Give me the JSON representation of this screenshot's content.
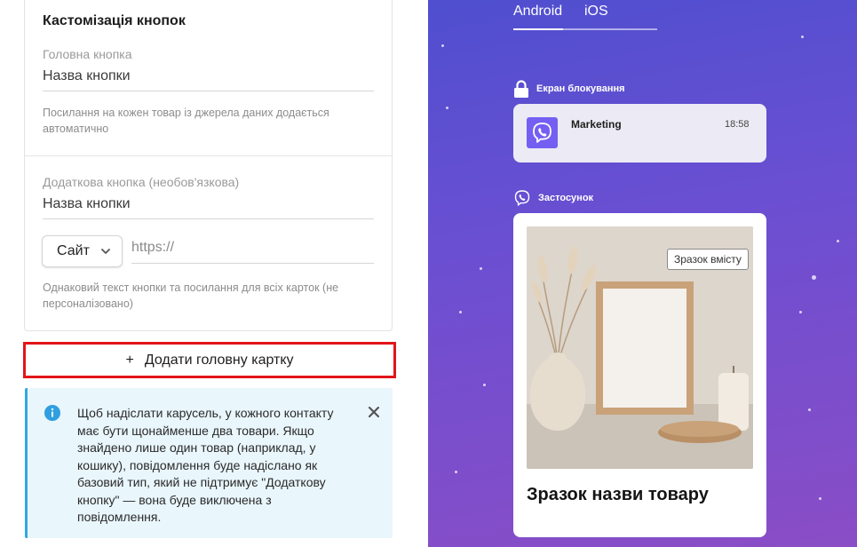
{
  "customization": {
    "title": "Кастомізація кнопок",
    "main_button": {
      "label": "Головна кнопка",
      "value": "Назва кнопки",
      "hint": "Посилання на кожен товар із джерела даних додається автоматично"
    },
    "extra_button": {
      "label": "Додаткова кнопка (необов'язкова)",
      "value": "Назва кнопки",
      "type_selected": "Сайт",
      "url_placeholder": "https://",
      "hint": "Однаковий текст кнопки та посилання для всіх карток (не персоналізовано)"
    }
  },
  "add_card_button": {
    "icon": "+",
    "label": "Додати головну картку"
  },
  "info_box": {
    "text": "Щоб надіслати карусель, у кожного контакту має бути щонайменше два товари. Якщо знайдено лише один товар (наприклад, у кошику), повідомлення буде надіслано як базовий тип, який не підтримує \"Додаткову кнопку\" — вона буде виключена з повідомлення."
  },
  "preview": {
    "tabs": [
      {
        "label": "Android",
        "active": true
      },
      {
        "label": "iOS",
        "active": false
      }
    ],
    "lock_screen_label": "Екран блокування",
    "notification": {
      "app_icon": "viber-icon",
      "sender": "Marketing",
      "time": "18:58"
    },
    "app_label": "Застосунок",
    "product_card": {
      "badge": "Зразок вмісту",
      "title": "Зразок назви товару"
    }
  },
  "colors": {
    "highlight_border": "#e2151a",
    "info_background": "#e9f6fc",
    "info_accent": "#33a6e0",
    "viber_purple": "#7360f2",
    "preview_gradient_top": "#4f4fcf",
    "preview_gradient_bottom": "#8a4dc6"
  }
}
